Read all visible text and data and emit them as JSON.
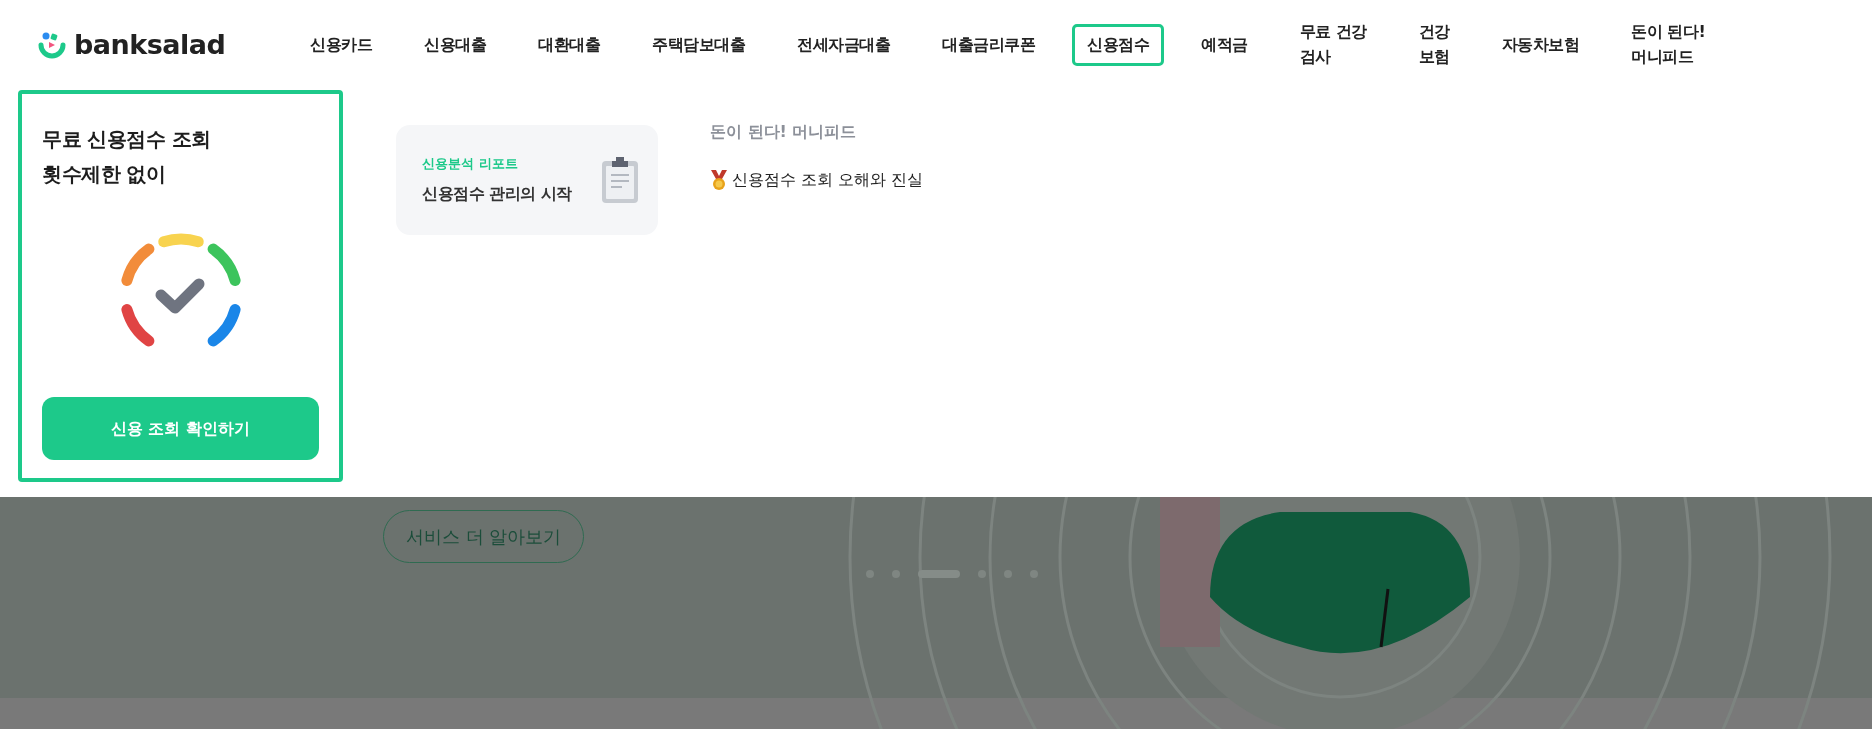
{
  "logo": {
    "text": "banksalad"
  },
  "nav": [
    {
      "lines": [
        "신용카드"
      ],
      "selected": false
    },
    {
      "lines": [
        "신용대출"
      ],
      "selected": false
    },
    {
      "lines": [
        "대환대출"
      ],
      "selected": false
    },
    {
      "lines": [
        "주택담보대출"
      ],
      "selected": false
    },
    {
      "lines": [
        "전세자금대출"
      ],
      "selected": false
    },
    {
      "lines": [
        "대출금리쿠폰"
      ],
      "selected": false
    },
    {
      "lines": [
        "신용점수"
      ],
      "selected": true
    },
    {
      "lines": [
        "예적금"
      ],
      "selected": false
    },
    {
      "lines": [
        "무료 건강",
        "검사"
      ],
      "selected": false
    },
    {
      "lines": [
        "건강",
        "보험"
      ],
      "selected": false
    },
    {
      "lines": [
        "자동차보험"
      ],
      "selected": false
    },
    {
      "lines": [
        "돈이 된다!",
        "머니피드"
      ],
      "selected": false
    }
  ],
  "dropdown": {
    "promo": {
      "title_lines": [
        "무료 신용점수 조회",
        "횟수제한 없이"
      ],
      "button": "신용 조회 확인하기"
    },
    "report_card": {
      "eyebrow": "신용분석 리포트",
      "title": "신용점수 관리의 시작"
    },
    "moneyfeed": {
      "heading": "돈이 된다! 머니피드",
      "articles": [
        {
          "title": "신용점수 조회 오해와 진실"
        }
      ]
    }
  },
  "hero": {
    "button": "서비스 더 알아보기",
    "slides": [
      {
        "selected": false
      },
      {
        "selected": false
      },
      {
        "selected": true
      },
      {
        "selected": false
      },
      {
        "selected": false
      },
      {
        "selected": false
      }
    ]
  }
}
